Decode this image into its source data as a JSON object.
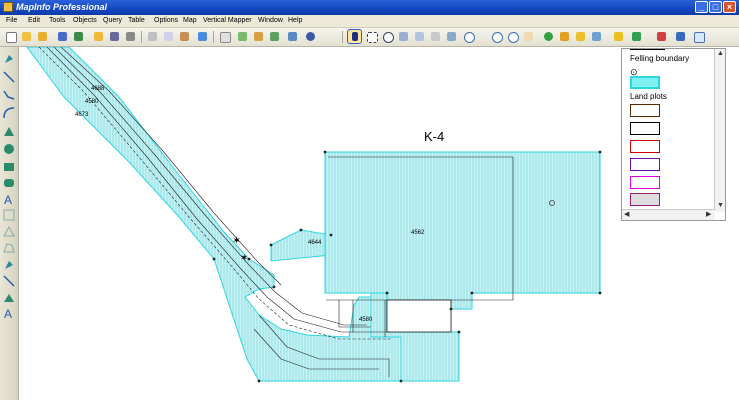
{
  "window": {
    "title": "MapInfo Professional",
    "min": "_",
    "max": "□",
    "close": "×"
  },
  "menu": [
    {
      "label": "File"
    },
    {
      "label": "Edit"
    },
    {
      "label": "Tools"
    },
    {
      "label": "Objects"
    },
    {
      "label": "Query"
    },
    {
      "label": "Table"
    },
    {
      "label": "Options"
    },
    {
      "label": "Map"
    },
    {
      "label": "Vertical Mapper"
    },
    {
      "label": "Window"
    },
    {
      "label": "Help"
    }
  ],
  "toolbar_icons": [
    "new-icon",
    "open-icon",
    "open-workspace-icon",
    "save-icon",
    "save-workspace-icon",
    "open-folder-icon",
    "save-copy-icon",
    "print-icon",
    "cut-icon",
    "copy-icon",
    "paste-icon",
    "undo-icon",
    "new-browser-icon",
    "new-mapper-icon",
    "new-grapher-icon",
    "new-layout-icon",
    "new-redistrict-icon",
    "help-icon",
    "select-icon",
    "marquee-select-icon",
    "radius-select-icon",
    "polygon-select-icon",
    "boundary-select-icon",
    "unselect-icon",
    "invert-select-icon",
    "zoom-in-icon",
    "zoom-out-icon",
    "change-view-icon",
    "grabber-icon",
    "info-icon",
    "label-icon",
    "ruler-icon",
    "drag-window-icon",
    "layer-control-icon",
    "legend-icon",
    "statistics-icon",
    "hotlink-icon"
  ],
  "drawing_tools": [
    "symbol-icon",
    "line-icon",
    "polyline-icon",
    "arc-icon",
    "polygon-icon",
    "ellipse-icon",
    "rectangle-icon",
    "rounded-rectangle-icon",
    "text-icon",
    "frame-icon",
    "reshape-icon",
    "add-node-icon",
    "symbol-style-icon",
    "line-style-icon",
    "region-style-icon",
    "text-style-icon"
  ],
  "map": {
    "title": "K-4",
    "labels": [
      "4688",
      "4580",
      "4673",
      "4562",
      "4644",
      "4580"
    ],
    "colors": {
      "fill": "#bff2f2",
      "outline": "#2ed6e0",
      "hatch": "#7fcfd8"
    }
  },
  "legend": {
    "title": "Felling boundary",
    "symbol": "⊙",
    "section": "Land plots",
    "swatches": [
      {
        "border": "#5a2a00",
        "fill": "#ffffff"
      },
      {
        "border": "#000000",
        "fill": "#ffffff"
      },
      {
        "border": "#cc0000",
        "fill": "#ffffff"
      },
      {
        "border": "#6a0dad",
        "fill": "#ffffff"
      },
      {
        "border": "#e000e0",
        "fill": "#ffffff"
      },
      {
        "border": "#9a1a7a",
        "fill": "#dddddd"
      }
    ]
  }
}
